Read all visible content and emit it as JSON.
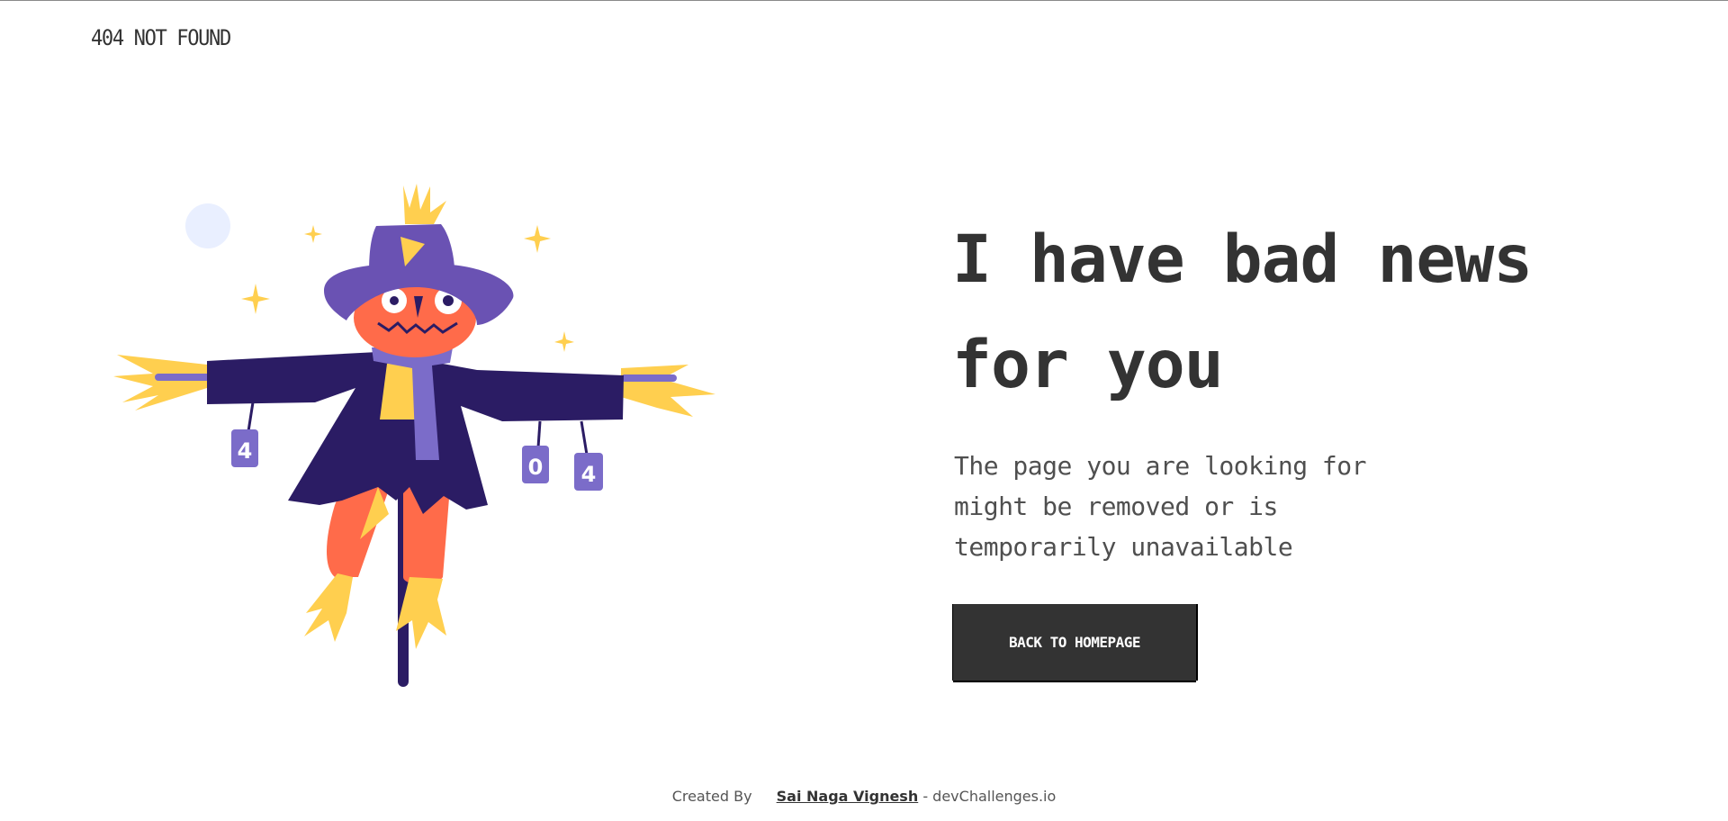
{
  "header": {
    "brand": "404 NOT FOUND"
  },
  "illustration": {
    "cans": [
      "4",
      "0",
      "4"
    ],
    "colors": {
      "hat": "#6a52b3",
      "coat": "#2b1c64",
      "face": "#ff6b4a",
      "straw": "#ffcf4f",
      "moon": "#e9efff",
      "can": "#7b6cc9",
      "pole": "#2b1c64"
    }
  },
  "main": {
    "headline": "I have bad news for you",
    "message": "The page you are looking for might be removed or is temporarily unavailable",
    "button_label": "BACK TO HOMEPAGE"
  },
  "footer": {
    "prefix": "Created By",
    "author": "Sai Naga Vignesh",
    "suffix": "- devChallenges.io"
  },
  "colors": {
    "text": "#333333",
    "button_bg": "#333333",
    "button_text": "#ffffff"
  }
}
